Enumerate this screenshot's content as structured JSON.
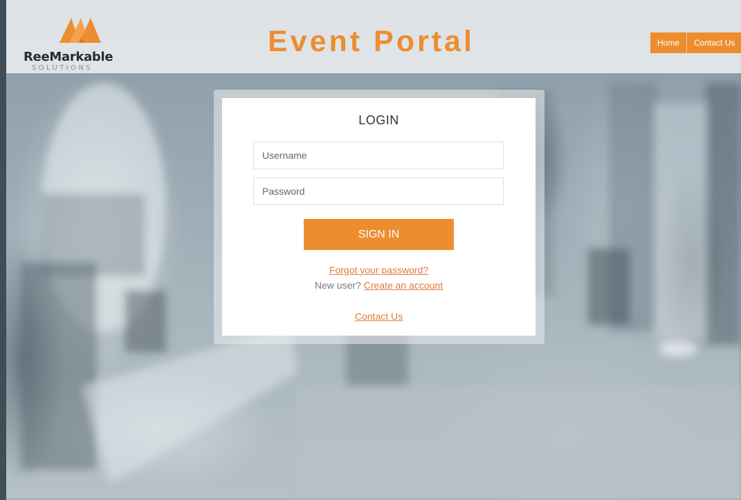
{
  "brand": {
    "name": "ReeMarkable",
    "tagline": "SOLUTIONS",
    "colors": {
      "orange": "#ec8e2f",
      "link": "#e07a3a"
    }
  },
  "header": {
    "title": "Event Portal",
    "nav": [
      {
        "label": "Home"
      },
      {
        "label": "Contact Us"
      }
    ]
  },
  "login": {
    "title": "LOGIN",
    "username_placeholder": "Username",
    "password_placeholder": "Password",
    "submit_label": "SIGN IN",
    "forgot_link": "Forgot your password?",
    "new_user_prefix": "New user?",
    "create_account_link": "Create an account",
    "contact_link": "Contact Us"
  }
}
